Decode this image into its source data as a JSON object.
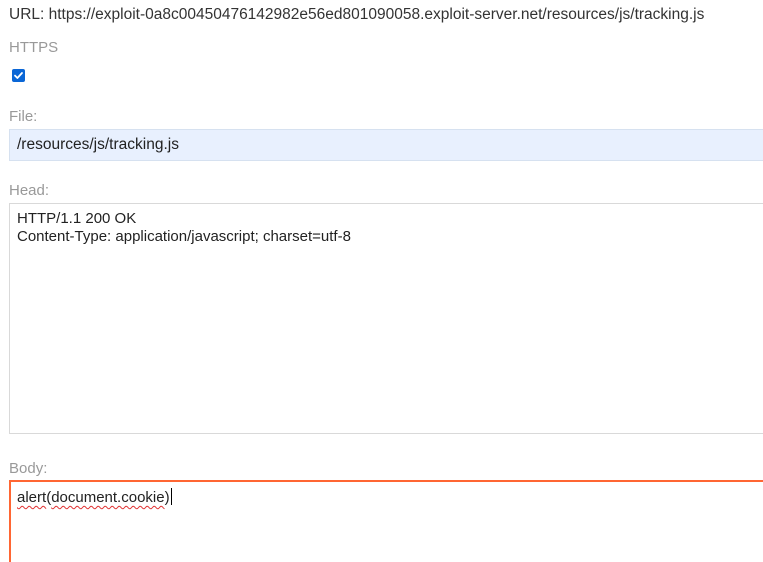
{
  "url_line": "URL: https://exploit-0a8c00450476142982e56ed801090058.exploit-server.net/resources/js/tracking.js",
  "https": {
    "label": "HTTPS",
    "checked": true
  },
  "file": {
    "label": "File:",
    "value": "/resources/js/tracking.js"
  },
  "head": {
    "label": "Head:",
    "value": "HTTP/1.1 200 OK\nContent-Type: application/javascript; charset=utf-8"
  },
  "body": {
    "label": "Body:",
    "value_part1": "alert",
    "value_part2": "(",
    "value_part3": "document.cookie",
    "value_part4": ")"
  },
  "colors": {
    "focus_border": "#ff6633",
    "autofill_bg": "#e8f0fe",
    "checkbox": "#0a66d6"
  }
}
